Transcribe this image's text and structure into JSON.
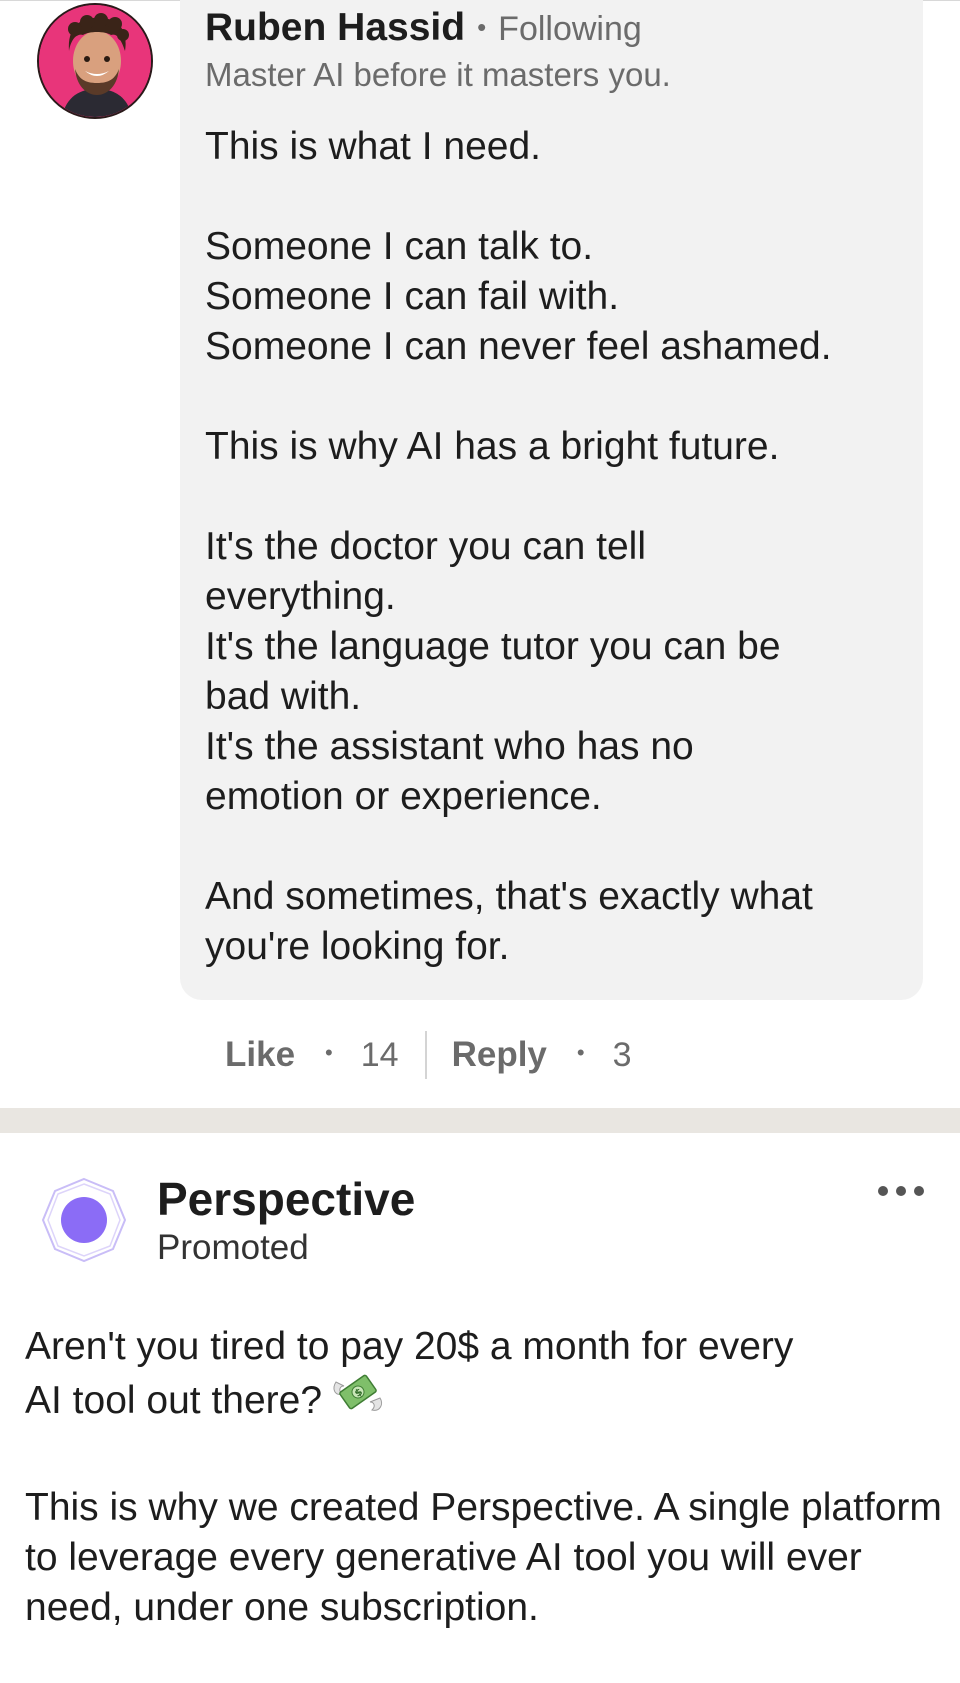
{
  "comment": {
    "author": "Ruben Hassid",
    "separator": "•",
    "relation": "Following",
    "headline": "Master AI before it masters you.",
    "paragraphs": [
      [
        "This is what I need."
      ],
      [
        "Someone I can talk to.",
        "Someone I can fail with.",
        "Someone I can never feel ashamed."
      ],
      [
        "This is why AI has a bright future."
      ],
      [
        "It's the doctor you can tell",
        "everything.",
        "It's the language tutor you can be",
        "bad with.",
        "It's the assistant who has no",
        "emotion or experience."
      ],
      [
        "And sometimes, that's exactly what",
        "you're looking for."
      ]
    ],
    "actions": {
      "like_label": "Like",
      "like_count": "14",
      "reply_label": "Reply",
      "reply_count": "3",
      "dot": "•"
    },
    "avatar_icon": "profile-photo"
  },
  "promo": {
    "brand": "Perspective",
    "label": "Promoted",
    "logo_icon": "octagon-circle-logo",
    "accent": "#8b6cf6",
    "more_icon": "ellipsis-icon",
    "text_line1": "Aren't you tired to pay 20$ a month for every",
    "text_line2": "AI tool out there?",
    "emoji_icon": "money-with-wings-icon",
    "text_para2": "This is why we created Perspective. A single platform to leverage every generative AI tool you will ever need, under one subscription."
  },
  "colors": {
    "bubble": "#f2f2f2",
    "text": "#1d1d1d",
    "muted": "#6b6b6b",
    "band": "#e9e6e1",
    "avatar_bg": "#e8357a"
  }
}
